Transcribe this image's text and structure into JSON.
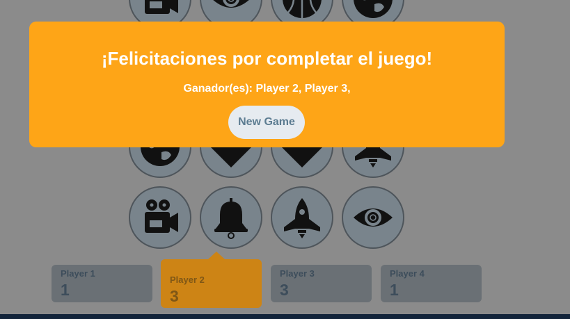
{
  "modal": {
    "title": "¡Felicitaciones por completar el juego!",
    "winners": "Ganador(es): Player 2, Player 3,",
    "new_game_label": "New Game"
  },
  "board": {
    "tiles": [
      {
        "icon": "film-camera-icon"
      },
      {
        "icon": "eye-icon"
      },
      {
        "icon": "basketball-icon"
      },
      {
        "icon": "globe-icon"
      },
      {
        "icon": "globe-icon"
      },
      {
        "icon": "diamond-icon"
      },
      {
        "icon": "diamond-icon"
      },
      {
        "icon": "rocket-icon"
      },
      {
        "icon": "film-camera-icon"
      },
      {
        "icon": "bell-icon"
      },
      {
        "icon": "rocket-icon"
      },
      {
        "icon": "eye-icon"
      }
    ]
  },
  "players": [
    {
      "name": "Player 1",
      "score": "1"
    },
    {
      "name": "Player 2",
      "score": "3",
      "active": true
    },
    {
      "name": "Player 3",
      "score": "3"
    },
    {
      "name": "Player 4",
      "score": "1"
    }
  ],
  "colors": {
    "overlay_bg": "#8b8b8b",
    "modal_bg": "#fea517",
    "active_player": "#cd8415",
    "tile_bg": "#79848c"
  }
}
